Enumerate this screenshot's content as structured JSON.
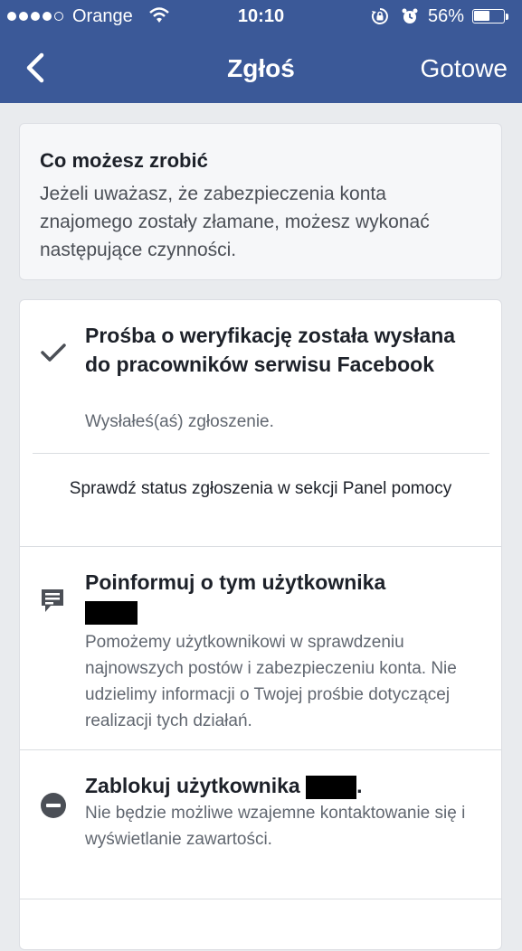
{
  "status_bar": {
    "carrier": "Orange",
    "time": "10:10",
    "battery_percent": "56%",
    "battery_level": 0.56
  },
  "nav": {
    "back_icon": "chevron-left-icon",
    "title": "Zgłoś",
    "done_label": "Gotowe"
  },
  "intro": {
    "title": "Co możesz zrobić",
    "text": "Jeżeli uważasz, że zabezpieczenia konta znajomego zostały złamane, możesz wykonać następujące czynności."
  },
  "items": [
    {
      "icon": "checkmark-icon",
      "title": "Prośba o weryfikację została wysłana do pracowników serwisu Facebook",
      "subtitle": "Wysłałeś(aś) zgłoszenie."
    },
    {
      "link": "Sprawdź status zgłoszenia w sekcji Panel pomocy"
    },
    {
      "icon": "message-icon",
      "title": "Poinformuj o tym użytkownika",
      "subtitle": "Pomożemy użytkownikowi w sprawdzeniu najnowszych postów i zabezpieczeniu konta. Nie udzielimy informacji o Twojej prośbie dotyczącej realizacji tych działań."
    },
    {
      "icon": "block-icon",
      "title": "Zablokuj użytkownika",
      "title_suffix": ".",
      "subtitle": "Nie będzie możliwe wzajemne kontaktowanie się i wyświetlanie zawartości."
    }
  ]
}
